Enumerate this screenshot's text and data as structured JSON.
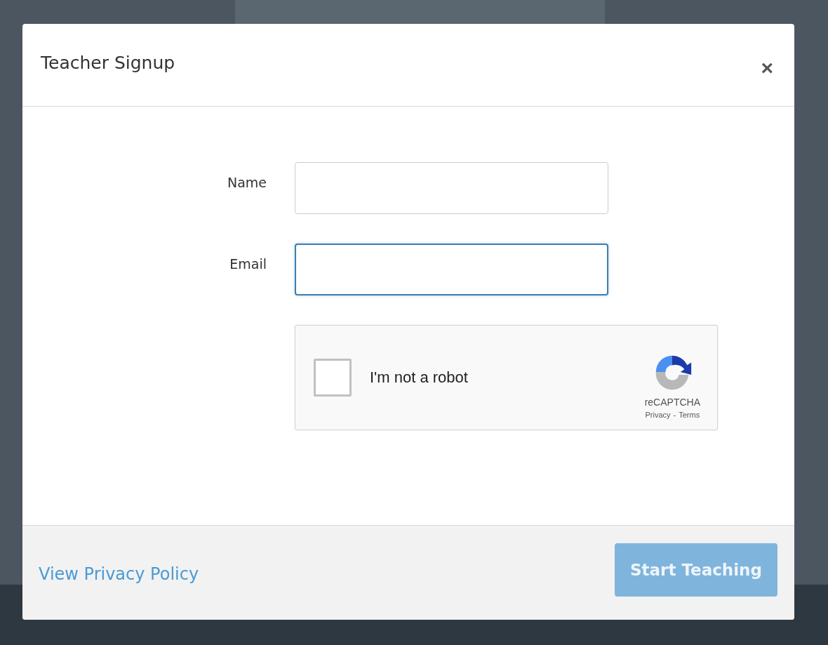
{
  "dialog": {
    "title": "Teacher Signup",
    "close": "×"
  },
  "fields": [
    {
      "label": "Name",
      "focused": false
    },
    {
      "label": "Email",
      "focused": true
    }
  ],
  "captcha": {
    "label": "I'm not a robot",
    "checked": false,
    "brand": "reCAPTCHA",
    "privacy": "Privacy",
    "separator": "-",
    "terms": "Terms"
  },
  "footer": {
    "link": "View Privacy Policy",
    "button": {
      "label": "Start Teaching",
      "disabled": true
    }
  }
}
